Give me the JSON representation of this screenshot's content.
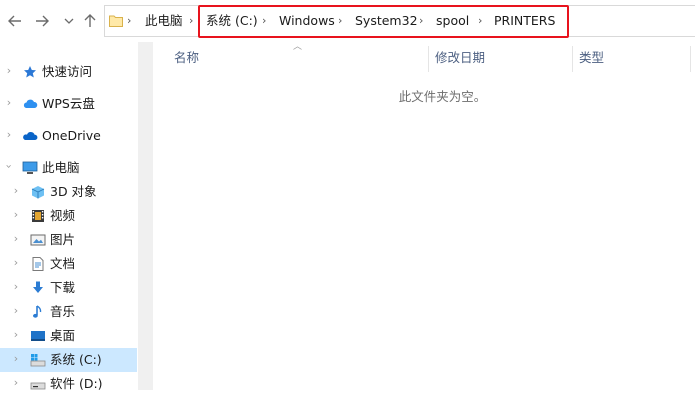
{
  "nav": {
    "back_icon": "arrow-left-icon",
    "forward_icon": "arrow-right-icon",
    "recent_icon": "chevron-down-icon",
    "up_icon": "arrow-up-icon"
  },
  "breadcrumb": [
    "此电脑",
    "系统 (C:)",
    "Windows",
    "System32",
    "spool",
    "PRINTERS"
  ],
  "columns": {
    "name": "名称",
    "modified": "修改日期",
    "type": "类型"
  },
  "empty_message": "此文件夹为空。",
  "sidebar": {
    "items": [
      {
        "label": "快速访问",
        "icon": "star-icon"
      },
      {
        "label": "WPS云盘",
        "icon": "cloud-icon"
      },
      {
        "label": "OneDrive",
        "icon": "onedrive-cloud-icon"
      },
      {
        "label": "此电脑",
        "icon": "computer-icon"
      },
      {
        "label": "3D 对象",
        "icon": "cube-icon"
      },
      {
        "label": "视频",
        "icon": "film-icon"
      },
      {
        "label": "图片",
        "icon": "picture-icon"
      },
      {
        "label": "文档",
        "icon": "document-icon"
      },
      {
        "label": "下载",
        "icon": "download-icon"
      },
      {
        "label": "音乐",
        "icon": "music-note-icon"
      },
      {
        "label": "桌面",
        "icon": "desktop-icon"
      },
      {
        "label": "系统 (C:)",
        "icon": "drive-c-icon",
        "selected": true
      },
      {
        "label": "软件 (D:)",
        "icon": "drive-d-icon"
      }
    ]
  },
  "colors": {
    "highlight_box": "#e8131d",
    "selection": "#cce8ff",
    "header_text": "#4d6082"
  }
}
